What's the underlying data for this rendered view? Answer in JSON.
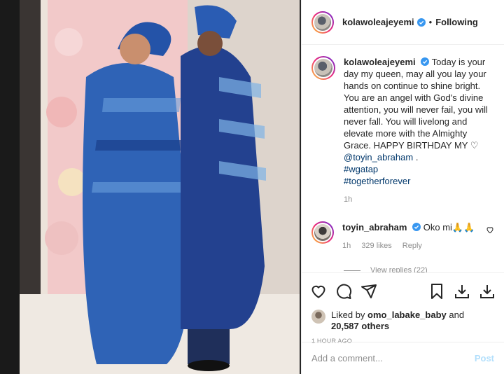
{
  "header": {
    "username": "kolawoleajeyemi",
    "separator": "•",
    "follow_status": "Following"
  },
  "caption": {
    "username": "kolawoleajeyemi",
    "text": "Today is your day my queen, may all you lay your hands on continue to shine bright. You are an angel with God's divine attention, you will never fail, you will never fall. You will livelong and elevate more with the Almighty Grace. HAPPY BIRTHDAY MY",
    "heart_glyph": "♡",
    "mention": "@toyin_abraham",
    "mention_suffix": " .",
    "hashtags": [
      "#wgatap",
      "#togetherforever"
    ],
    "time": "1h"
  },
  "reply": {
    "username": "toyin_abraham",
    "text": "Oko mi🙏🙏",
    "time": "1h",
    "likes": "329 likes",
    "reply_label": "Reply",
    "view_replies": "View replies (22)"
  },
  "likes": {
    "prefix": "Liked by ",
    "user": "omo_labake_baby",
    "middle": " and",
    "count": "20,587 others"
  },
  "timestamp": "1 HOUR AGO",
  "comment_box": {
    "placeholder": "Add a comment...",
    "post_label": "Post"
  },
  "colors": {
    "verified": "#3897f0",
    "link": "#00376b",
    "post_disabled": "#b2dffc",
    "muted": "#8e8e8e"
  }
}
